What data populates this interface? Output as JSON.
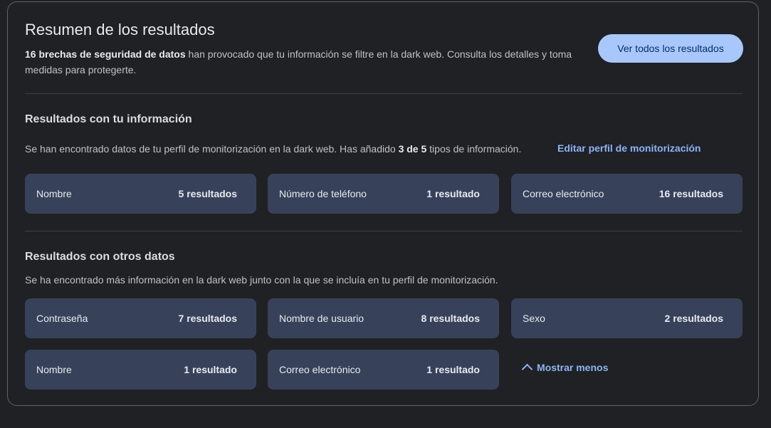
{
  "summary": {
    "title": "Resumen de los resultados",
    "bold_text": "16 brechas de seguridad de datos",
    "text": " han provocado que tu información se filtre en la dark web. Consulta los detalles y toma medidas para protegerte.",
    "view_all_button": "Ver todos los resultados"
  },
  "profile_section": {
    "title": "Resultados con tu información",
    "desc_before": "Se han encontrado datos de tu perfil de monitorización en la dark web. Has añadido ",
    "desc_bold": "3 de 5",
    "desc_after": " tipos de información.",
    "edit_link": "Editar perfil de monitorización",
    "tiles": [
      {
        "label": "Nombre",
        "count": "5 resultados"
      },
      {
        "label": "Número de teléfono",
        "count": "1 resultado"
      },
      {
        "label": "Correo electrónico",
        "count": "16 resultados"
      }
    ]
  },
  "other_section": {
    "title": "Resultados con otros datos",
    "desc": "Se ha encontrado más información en la dark web junto con la que se incluía en tu perfil de monitorización.",
    "tiles": [
      {
        "label": "Contraseña",
        "count": "7 resultados"
      },
      {
        "label": "Nombre de usuario",
        "count": "8 resultados"
      },
      {
        "label": "Sexo",
        "count": "2 resultados"
      },
      {
        "label": "Nombre",
        "count": "1 resultado"
      },
      {
        "label": "Correo electrónico",
        "count": "1 resultado"
      }
    ],
    "show_less": "Mostrar menos",
    "show_less_icon": "chevron-up-icon"
  },
  "colors": {
    "background": "#202124",
    "tile": "#37425a",
    "accent": "#8ab4f8",
    "button": "#a8c7fa"
  }
}
